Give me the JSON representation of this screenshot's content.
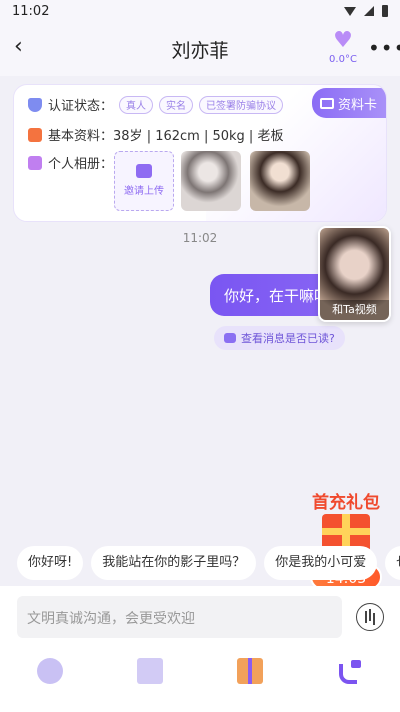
{
  "status_bar": {
    "time": "11:02"
  },
  "header": {
    "title": "刘亦菲",
    "back_icon": "back-arrow-icon",
    "temperature": "0.0°C",
    "more_label": "•••"
  },
  "profile_card": {
    "tag_label": "资料卡",
    "verify_label": "认证状态：",
    "badges": [
      "真人",
      "实名",
      "已签署防骗协议"
    ],
    "basic_label": "基本资料：",
    "basic_value": "38岁 | 162cm | 50kg | 老板",
    "album_label": "个人相册：",
    "upload_label": "邀请上传"
  },
  "chat": {
    "time": "11:02",
    "message": "你好，在干嘛呀",
    "read_check": "查看消息是否已读?"
  },
  "video_card": {
    "label": "和Ta视频"
  },
  "promo": {
    "title": "首充礼包",
    "timer": "14:03"
  },
  "quick_replies": [
    "你好呀!",
    "我能站在你的影子里吗？",
    "你是我的小可爱",
    "也想"
  ],
  "input": {
    "placeholder": "文明真诚沟通，会更受欢迎"
  },
  "colors": {
    "accent": "#7a56f2",
    "promo": "#f04a2e",
    "background": "#f1f0f7"
  }
}
